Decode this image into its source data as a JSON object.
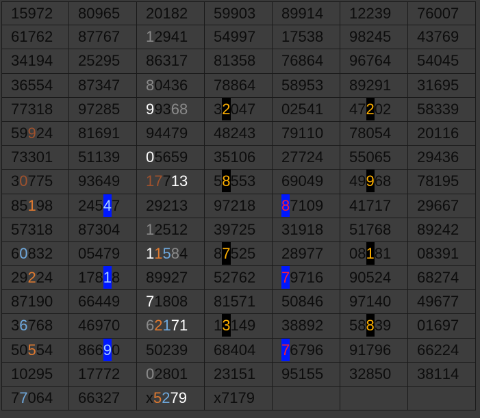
{
  "colors": {
    "default": "#0c0c0c",
    "gray": "#8a8a8a",
    "white": "#ffffff",
    "orange": "#e07a30",
    "brown": "#a0522d",
    "lightblue": "#6fa8dc",
    "yellow_on_black": "#ffb000",
    "blue_cell_bg": "#0018ff",
    "blue_cell_text_light": "#a8d0ff",
    "red": "#ff2030"
  },
  "rows": [
    [
      [
        "15972"
      ],
      [
        "80965"
      ],
      [
        "20182"
      ],
      [
        "59903"
      ],
      [
        "89914"
      ],
      [
        "12239"
      ],
      [
        "76007"
      ]
    ],
    [
      [
        "61762"
      ],
      [
        "87767"
      ],
      [
        "12941",
        {
          "0": "gray"
        }
      ],
      [
        "54997"
      ],
      [
        "17538"
      ],
      [
        "98245"
      ],
      [
        "43769"
      ]
    ],
    [
      [
        "34194"
      ],
      [
        "25295"
      ],
      [
        "86317"
      ],
      [
        "81358"
      ],
      [
        "76864"
      ],
      [
        "96764"
      ],
      [
        "54045"
      ]
    ],
    [
      [
        "36554"
      ],
      [
        "87347"
      ],
      [
        "80436",
        {
          "0": "gray"
        }
      ],
      [
        "78864"
      ],
      [
        "58953"
      ],
      [
        "89291"
      ],
      [
        "31695"
      ]
    ],
    [
      [
        "77318"
      ],
      [
        "97285"
      ],
      [
        "99368",
        {
          "0": "white",
          "3": "gray",
          "4": "gray"
        }
      ],
      [
        "32047",
        {
          "1": "bk"
        }
      ],
      [
        "02541"
      ],
      [
        "47202",
        {
          "2": "bk"
        }
      ],
      [
        "58339"
      ]
    ],
    [
      [
        "59924",
        {
          "2": "brown"
        }
      ],
      [
        "81691"
      ],
      [
        "94479"
      ],
      [
        "48243"
      ],
      [
        "79110"
      ],
      [
        "78054"
      ],
      [
        "20116"
      ]
    ],
    [
      [
        "73301"
      ],
      [
        "51139"
      ],
      [
        "05659",
        {
          "0": "white"
        }
      ],
      [
        "35106"
      ],
      [
        "27724"
      ],
      [
        "55065"
      ],
      [
        "29436"
      ]
    ],
    [
      [
        "30775",
        {
          "1": "brown"
        }
      ],
      [
        "93649"
      ],
      [
        "17713",
        {
          "0": "brown",
          "1": "brown",
          "3": "white",
          "4": "white"
        }
      ],
      [
        "58553",
        {
          "1": "bk"
        }
      ],
      [
        "69049"
      ],
      [
        "49968",
        {
          "2": "bk"
        }
      ],
      [
        "78195"
      ]
    ],
    [
      [
        "85198",
        {
          "2": "orange"
        }
      ],
      [
        "24547",
        {
          "3": "bl_light"
        }
      ],
      [
        "29213"
      ],
      [
        "97218"
      ],
      [
        "87109",
        {
          "0": "bl_red"
        }
      ],
      [
        "41717"
      ],
      [
        "29667"
      ]
    ],
    [
      [
        "57318"
      ],
      [
        "87304"
      ],
      [
        "12512",
        {
          "0": "gray"
        }
      ],
      [
        "39725"
      ],
      [
        "31918"
      ],
      [
        "51768"
      ],
      [
        "89242"
      ]
    ],
    [
      [
        "60832",
        {
          "1": "lightblue"
        }
      ],
      [
        "05479"
      ],
      [
        "11584",
        {
          "0": "white",
          "1": "orange",
          "2": "lightblue",
          "3": "gray"
        }
      ],
      [
        "87525",
        {
          "1": "bk"
        }
      ],
      [
        "28977"
      ],
      [
        "08181",
        {
          "2": "bk"
        }
      ],
      [
        "08391"
      ]
    ],
    [
      [
        "29224",
        {
          "2": "orange"
        }
      ],
      [
        "17818",
        {
          "3": "bl_light"
        }
      ],
      [
        "89927"
      ],
      [
        "52762"
      ],
      [
        "79716",
        {
          "0": "bl_red"
        }
      ],
      [
        "90524"
      ],
      [
        "68274"
      ]
    ],
    [
      [
        "87190"
      ],
      [
        "66449"
      ],
      [
        "71808",
        {
          "0": "white"
        }
      ],
      [
        "81571"
      ],
      [
        "50846"
      ],
      [
        "97140"
      ],
      [
        "49677"
      ]
    ],
    [
      [
        "36768",
        {
          "1": "lightblue"
        }
      ],
      [
        "46970"
      ],
      [
        "62171",
        {
          "0": "gray",
          "1": "orange",
          "2": "lightblue",
          "3": "white",
          "4": "white"
        }
      ],
      [
        "13149",
        {
          "1": "bk"
        }
      ],
      [
        "38892"
      ],
      [
        "58839",
        {
          "2": "bk"
        }
      ],
      [
        "01697"
      ]
    ],
    [
      [
        "50554",
        {
          "2": "orange"
        }
      ],
      [
        "86690",
        {
          "3": "bl_light"
        }
      ],
      [
        "50239"
      ],
      [
        "68404"
      ],
      [
        "76796",
        {
          "0": "bl_red"
        }
      ],
      [
        "91796"
      ],
      [
        "66224"
      ]
    ],
    [
      [
        "10295"
      ],
      [
        "17772"
      ],
      [
        "02801",
        {
          "0": "gray"
        }
      ],
      [
        "23151"
      ],
      [
        "95155"
      ],
      [
        "32850"
      ],
      [
        "38114"
      ]
    ],
    [
      [
        "77064",
        {
          "1": "lightblue"
        }
      ],
      [
        "66327"
      ],
      [
        "x5279",
        {
          "1": "orange",
          "2": "lightblue",
          "3": "white",
          "4": "white"
        }
      ],
      [
        "x7179"
      ],
      [
        ""
      ],
      [
        ""
      ],
      [
        ""
      ]
    ]
  ]
}
